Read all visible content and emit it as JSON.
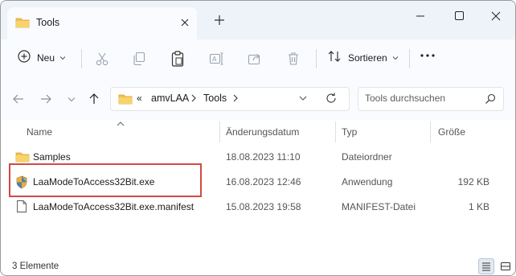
{
  "tab": {
    "title": "Tools"
  },
  "toolbar": {
    "new_label": "Neu",
    "sort_label": "Sortieren"
  },
  "address": {
    "sep": "«",
    "path": [
      "amvLAA",
      "Tools"
    ]
  },
  "search": {
    "placeholder": "Tools durchsuchen"
  },
  "columns": {
    "name": "Name",
    "date": "Änderungsdatum",
    "type": "Typ",
    "size": "Größe"
  },
  "files": [
    {
      "name": "Samples",
      "date": "18.08.2023 11:10",
      "type": "Dateiordner",
      "size": "",
      "icon": "folder-icon"
    },
    {
      "name": "LaaModeToAccess32Bit.exe",
      "date": "16.08.2023 12:46",
      "type": "Anwendung",
      "size": "192 KB",
      "icon": "exe-shield-icon"
    },
    {
      "name": "LaaModeToAccess32Bit.exe.manifest",
      "date": "15.08.2023 19:58",
      "type": "MANIFEST-Datei",
      "size": "1 KB",
      "icon": "file-icon"
    }
  ],
  "status": {
    "count": "3 Elemente"
  },
  "colors": {
    "highlight": "#d14a45",
    "folder": "#f2c04e",
    "accent": "#0067c0"
  }
}
